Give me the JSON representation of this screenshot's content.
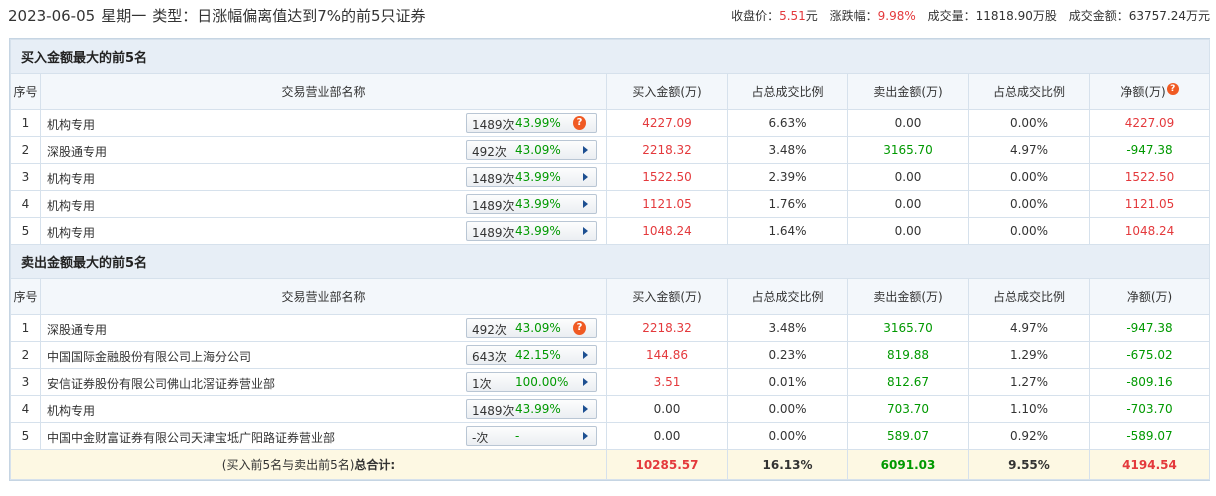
{
  "header": {
    "date": "2023-06-05",
    "weekday": "星期一",
    "type_label": "类型：日涨幅偏离值达到7%的前5只证券",
    "close_label": "收盘价：",
    "close_value": "5.51",
    "close_unit": "元",
    "change_label": "涨跌幅：",
    "change_value": "9.98%",
    "volume_label": "成交量：",
    "volume_value": "11818.90万股",
    "turnover_label": "成交金额：",
    "turnover_value": "63757.24万元"
  },
  "columns": {
    "seq": "序号",
    "name": "交易营业部名称",
    "buy": "买入金额(万)",
    "buy_ratio": "占总成交比例",
    "sell": "卖出金额(万)",
    "sell_ratio": "占总成交比例",
    "net": "净额(万)"
  },
  "buy_section": {
    "title": "买入金额最大的前5名",
    "rows": [
      {
        "seq": "1",
        "name": "机构专用",
        "count": "1489次",
        "pct": "43.99%",
        "icon": "question-icon",
        "buy": "4227.09",
        "buy_ratio": "6.63%",
        "sell": "0.00",
        "sell_ratio": "0.00%",
        "net": "4227.09"
      },
      {
        "seq": "2",
        "name": "深股通专用",
        "count": "492次",
        "pct": "43.09%",
        "icon": "arrow-right-icon",
        "buy": "2218.32",
        "buy_ratio": "3.48%",
        "sell": "3165.70",
        "sell_ratio": "4.97%",
        "net": "-947.38"
      },
      {
        "seq": "3",
        "name": "机构专用",
        "count": "1489次",
        "pct": "43.99%",
        "icon": "arrow-right-icon",
        "buy": "1522.50",
        "buy_ratio": "2.39%",
        "sell": "0.00",
        "sell_ratio": "0.00%",
        "net": "1522.50"
      },
      {
        "seq": "4",
        "name": "机构专用",
        "count": "1489次",
        "pct": "43.99%",
        "icon": "arrow-right-icon",
        "buy": "1121.05",
        "buy_ratio": "1.76%",
        "sell": "0.00",
        "sell_ratio": "0.00%",
        "net": "1121.05"
      },
      {
        "seq": "5",
        "name": "机构专用",
        "count": "1489次",
        "pct": "43.99%",
        "icon": "arrow-right-icon",
        "buy": "1048.24",
        "buy_ratio": "1.64%",
        "sell": "0.00",
        "sell_ratio": "0.00%",
        "net": "1048.24"
      }
    ]
  },
  "sell_section": {
    "title": "卖出金额最大的前5名",
    "rows": [
      {
        "seq": "1",
        "name": "深股通专用",
        "count": "492次",
        "pct": "43.09%",
        "icon": "question-icon",
        "buy": "2218.32",
        "buy_ratio": "3.48%",
        "sell": "3165.70",
        "sell_ratio": "4.97%",
        "net": "-947.38"
      },
      {
        "seq": "2",
        "name": "中国国际金融股份有限公司上海分公司",
        "count": "643次",
        "pct": "42.15%",
        "icon": "arrow-right-icon",
        "buy": "144.86",
        "buy_ratio": "0.23%",
        "sell": "819.88",
        "sell_ratio": "1.29%",
        "net": "-675.02"
      },
      {
        "seq": "3",
        "name": "安信证券股份有限公司佛山北滘证券营业部",
        "count": "1次",
        "pct": "100.00%",
        "icon": "arrow-right-icon",
        "buy": "3.51",
        "buy_ratio": "0.01%",
        "sell": "812.67",
        "sell_ratio": "1.27%",
        "net": "-809.16"
      },
      {
        "seq": "4",
        "name": "机构专用",
        "count": "1489次",
        "pct": "43.99%",
        "icon": "arrow-right-icon",
        "buy": "0.00",
        "buy_ratio": "0.00%",
        "sell": "703.70",
        "sell_ratio": "1.10%",
        "net": "-703.70"
      },
      {
        "seq": "5",
        "name": "中国中金财富证券有限公司天津宝坻广阳路证券营业部",
        "count": "-次",
        "pct": "-",
        "icon": "arrow-right-icon",
        "buy": "0.00",
        "buy_ratio": "0.00%",
        "sell": "589.07",
        "sell_ratio": "0.92%",
        "net": "-589.07"
      }
    ]
  },
  "total": {
    "label_prefix": "(买入前5名与卖出前5名)",
    "label_bold": "总合计:",
    "buy": "10285.57",
    "buy_ratio": "16.13%",
    "sell": "6091.03",
    "sell_ratio": "9.55%",
    "net": "4194.54"
  },
  "colors": {
    "positive": "#e4393c",
    "negative": "#009900"
  }
}
